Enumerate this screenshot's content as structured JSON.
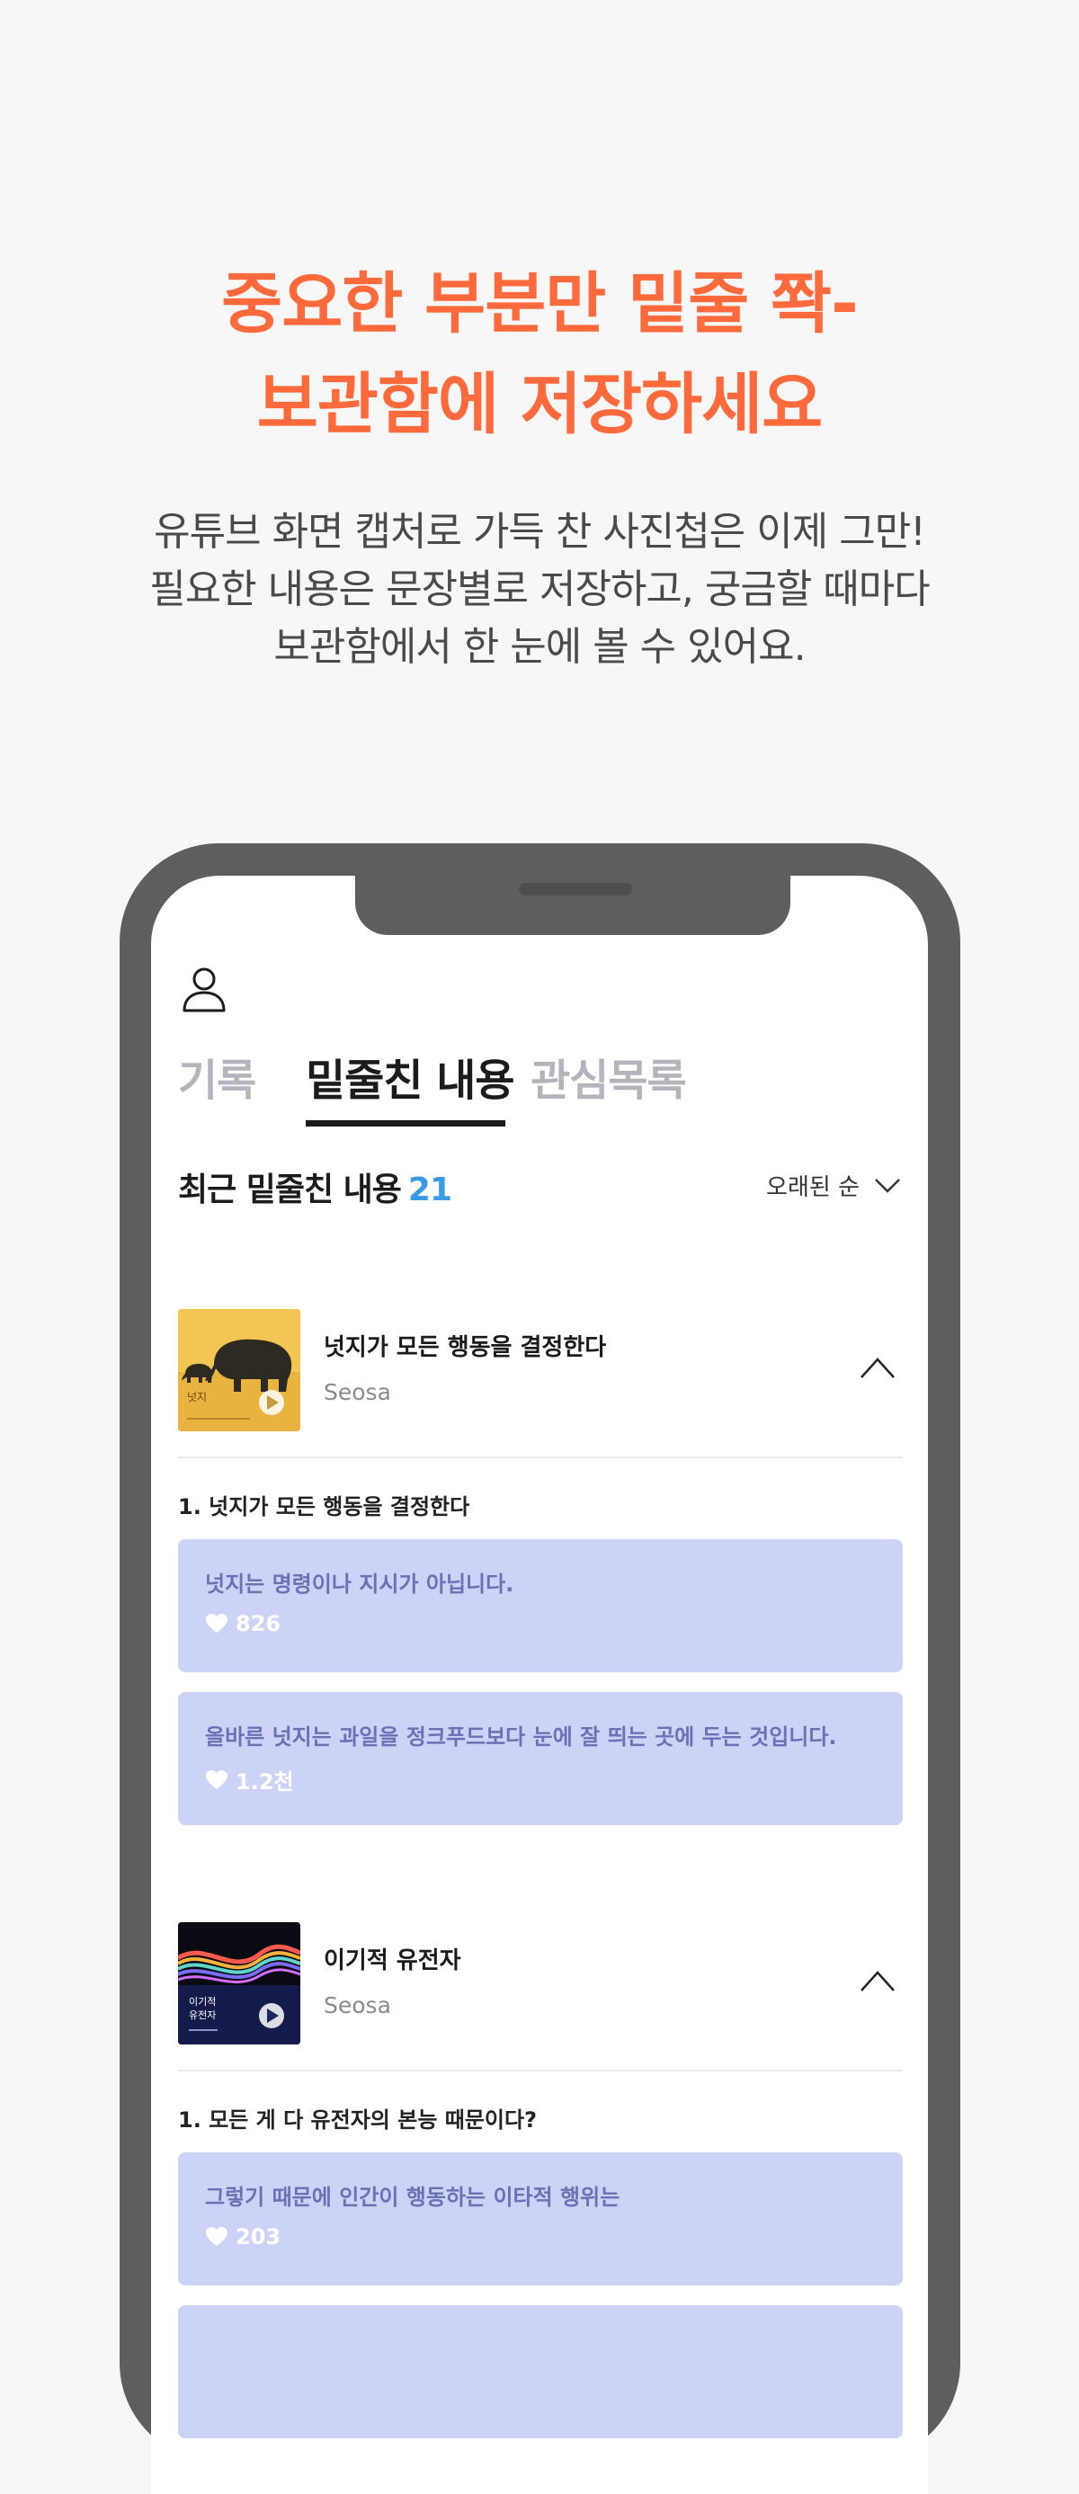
{
  "hero": {
    "title_line1": "중요한 부분만 밑줄 쫙-",
    "title_line2": "보관함에 저장하세요",
    "desc_line1": "유튜브 화면 캡처로 가득 찬 사진첩은 이제 그만!",
    "desc_line2": "필요한 내용은 문장별로 저장하고, 궁금할 때마다",
    "desc_line3": "보관함에서 한 눈에 볼 수 있어요."
  },
  "colors": {
    "accent": "#ff6a3d",
    "count_blue": "#3a9ae8",
    "highlight_card": "#cdd3f6",
    "highlight_text": "#6a72b5"
  },
  "app": {
    "profile_icon": "person-icon",
    "tabs": [
      {
        "label": "기록",
        "active": false
      },
      {
        "label": "밑줄친 내용",
        "active": true
      },
      {
        "label": "관심목록",
        "active": false
      }
    ],
    "section": {
      "title": "최근 밑줄친 내용",
      "count": "21",
      "sort_label": "오래된 순",
      "sort_icon": "chevron-down-icon"
    },
    "books": [
      {
        "title": "넛지가 모든 행동을 결정한다",
        "author": "Seosa",
        "cover_text": "넛지",
        "chapter": "1. 넛지가 모든 행동을 결정한다",
        "highlights": [
          {
            "text": "넛지는 명령이나 지시가 아닙니다.",
            "likes": "826"
          },
          {
            "text": "올바른 넛지는 과일을 정크푸드보다 눈에 잘 띄는 곳에 두는 것입니다.",
            "likes": "1.2천"
          }
        ]
      },
      {
        "title": "이기적 유전자",
        "author": "Seosa",
        "cover_line1": "이기적",
        "cover_line2": "유전자",
        "chapter": "1. 모든 게 다 유전자의 본능 때문이다?",
        "highlights": [
          {
            "text": "그렇기 때문에 인간이 행동하는 이타적 행위는",
            "likes": "203"
          }
        ]
      }
    ]
  }
}
